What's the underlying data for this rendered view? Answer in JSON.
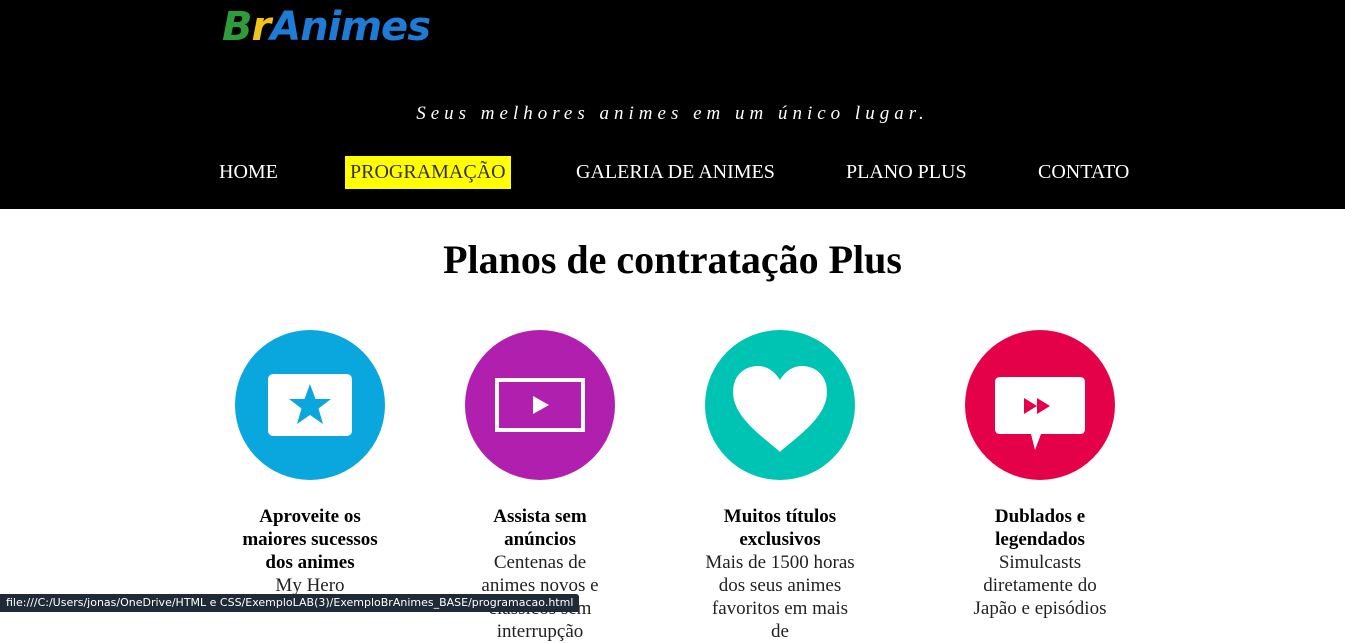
{
  "header": {
    "logo": {
      "part_b": "B",
      "part_r": "r",
      "part_rest": "Animes"
    },
    "tagline": "Seus melhores animes em um único lugar.",
    "nav": [
      {
        "label": "HOME",
        "active": false
      },
      {
        "label": "PROGRAMAÇÃO",
        "active": true
      },
      {
        "label": "GALERIA DE ANIMES",
        "active": false
      },
      {
        "label": "PLANO PLUS",
        "active": false
      },
      {
        "label": "CONTATO",
        "active": false
      }
    ]
  },
  "main": {
    "title": "Planos de contratação Plus",
    "features": [
      {
        "icon": "star-screen-icon",
        "color": "#0aa6de",
        "title": "Aproveite os maiores sucessos dos animes",
        "description": "My Hero"
      },
      {
        "icon": "play-screen-icon",
        "color": "#b01fae",
        "title": "Assista sem anúncios",
        "description": "Centenas de animes novos e clássicos sem interrupção"
      },
      {
        "icon": "heart-icon",
        "color": "#00c4b3",
        "title": "Muitos títulos exclusivos",
        "description": "Mais de 1500 horas dos seus animes favoritos em mais de"
      },
      {
        "icon": "fast-forward-chat-icon",
        "color": "#e5004a",
        "title": "Dublados e legendados",
        "description": "Simulcasts diretamente do Japão e episódios"
      }
    ]
  },
  "status_bar": {
    "url": "file:///C:/Users/jonas/OneDrive/HTML e CSS/ExemploLAB(3)/ExemploBrAnimes_BASE/programacao.html"
  },
  "colors": {
    "header_bg": "#000000",
    "active_nav_bg": "#ffff00"
  }
}
